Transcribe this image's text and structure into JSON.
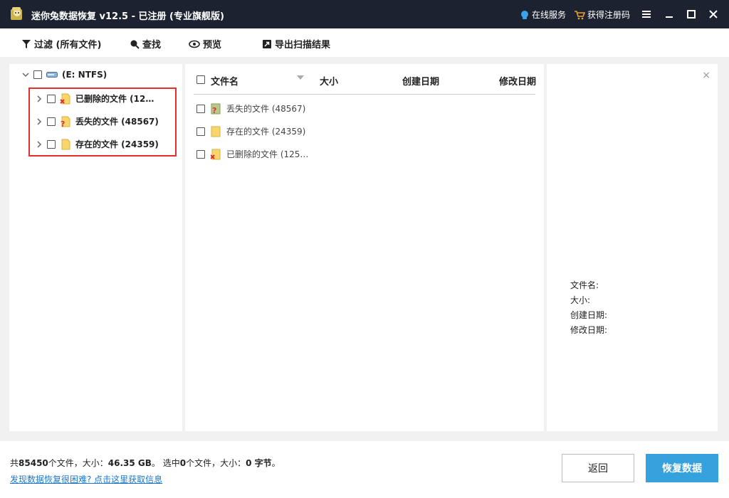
{
  "app": {
    "title": "迷你兔数据恢复 v12.5 - 已注册 (专业旗舰版)",
    "online_service": "在线服务",
    "get_code": "获得注册码"
  },
  "toolbar": {
    "filter_label": "过滤 (所有文件)",
    "find_label": "查找",
    "preview_label": "预览",
    "export_label": "导出扫描结果"
  },
  "tree": {
    "drive_label": "(E: NTFS)",
    "items": [
      {
        "label": "已删除的文件 (12…",
        "icon": "deleted-folder-icon"
      },
      {
        "label": "丢失的文件 (48567)",
        "icon": "lost-folder-icon"
      },
      {
        "label": "存在的文件 (24359)",
        "icon": "existing-folder-icon"
      }
    ]
  },
  "list": {
    "columns": {
      "name": "文件名",
      "size": "大小",
      "created": "创建日期",
      "modified": "修改日期"
    },
    "rows": [
      {
        "name": "丢失的文件 (48567)",
        "icon": "lost-folder-icon"
      },
      {
        "name": "存在的文件 (24359)",
        "icon": "existing-folder-icon"
      },
      {
        "name": "已删除的文件 (125…",
        "icon": "deleted-folder-icon"
      }
    ]
  },
  "preview": {
    "close": "×",
    "file_name_label": "文件名:",
    "size_label": "大小:",
    "created_label": "创建日期:",
    "modified_label": "修改日期:"
  },
  "status": {
    "total_prefix": "共",
    "total_count": "85450",
    "total_mid": "个文件，大小：",
    "total_size": "46.35 GB",
    "selected_prefix": "。 选中",
    "selected_count": "0",
    "selected_mid": "个文件，大小：",
    "selected_size": "0 字节",
    "selected_suffix": "。",
    "help_link": "发现数据恢复很困难? 点击这里获取信息"
  },
  "buttons": {
    "back": "返回",
    "recover": "恢复数据"
  },
  "colors": {
    "titlebar": "#1c2230",
    "accent": "#35a1dd",
    "highlight": "#e0312f",
    "link": "#1e77c9"
  }
}
